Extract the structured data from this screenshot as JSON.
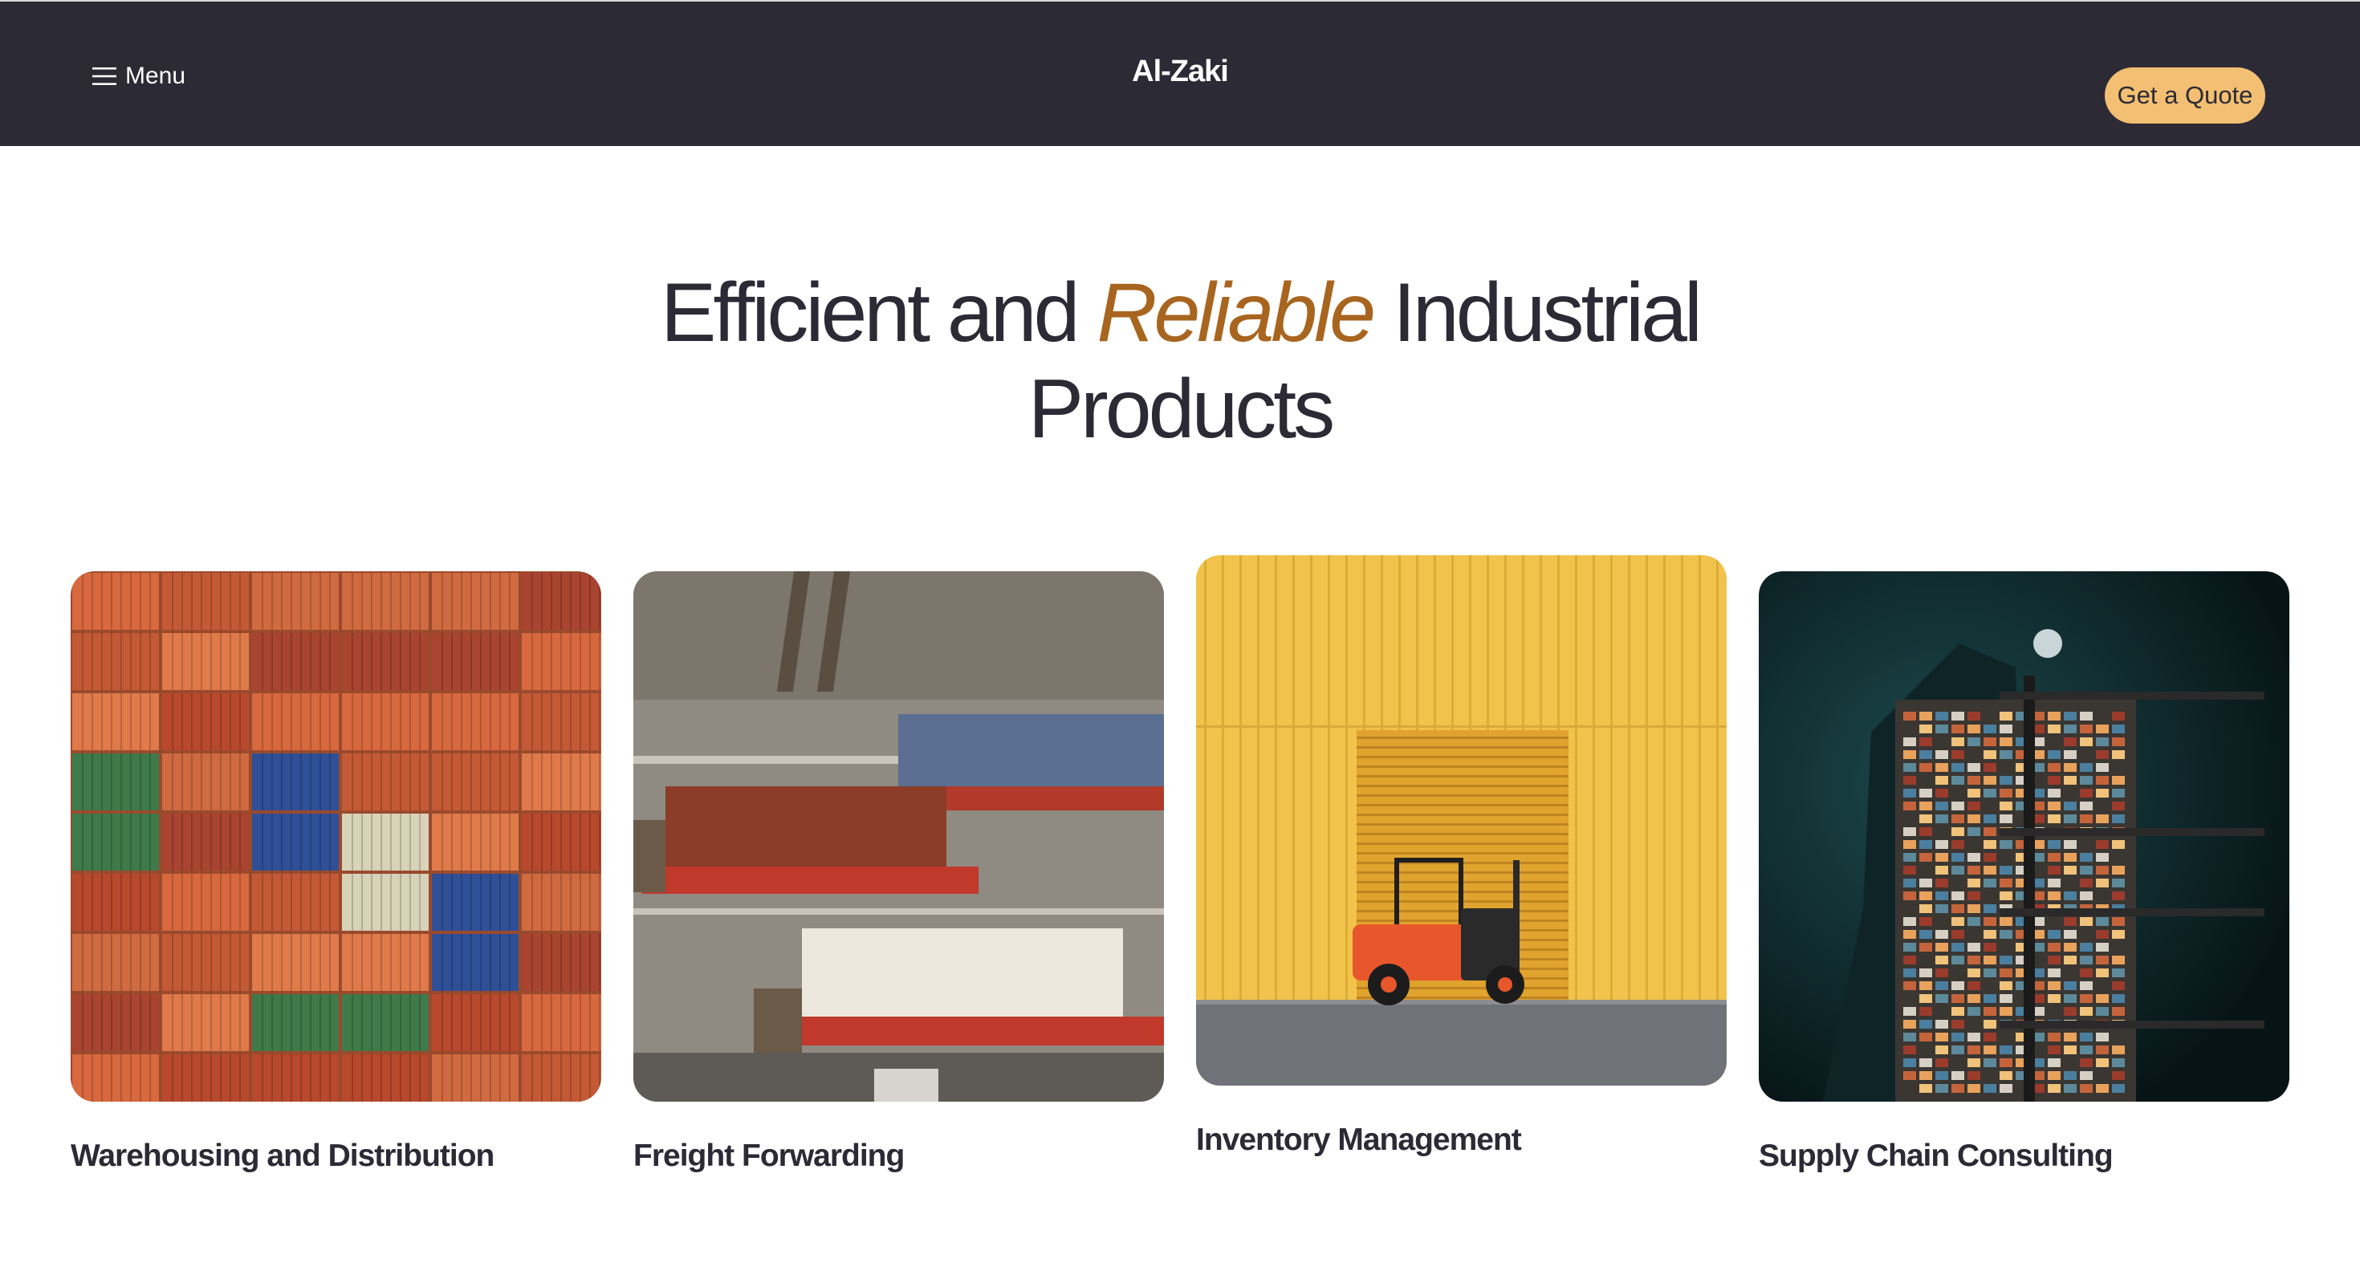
{
  "header": {
    "menu_label": "Menu",
    "menu_icon": "hamburger-icon",
    "brand": "Al-Zaki",
    "cta_label": "Get a Quote",
    "background_color": "#2b2a35",
    "cta_color": "#f3bf73"
  },
  "hero": {
    "title_part1": "Efficient and",
    "title_accent": "Reliable",
    "title_part2": "Industrial",
    "title_line2": "Products",
    "accent_color": "#a8651f"
  },
  "services": [
    {
      "label": "Warehousing and Distribution",
      "image": "stacked-shipping-containers-photo"
    },
    {
      "label": "Freight Forwarding",
      "image": "container-trucks-aerial-photo"
    },
    {
      "label": "Inventory Management",
      "image": "forklift-yellow-warehouse-photo"
    },
    {
      "label": "Supply Chain Consulting",
      "image": "cargo-port-aerial-night-photo"
    }
  ]
}
